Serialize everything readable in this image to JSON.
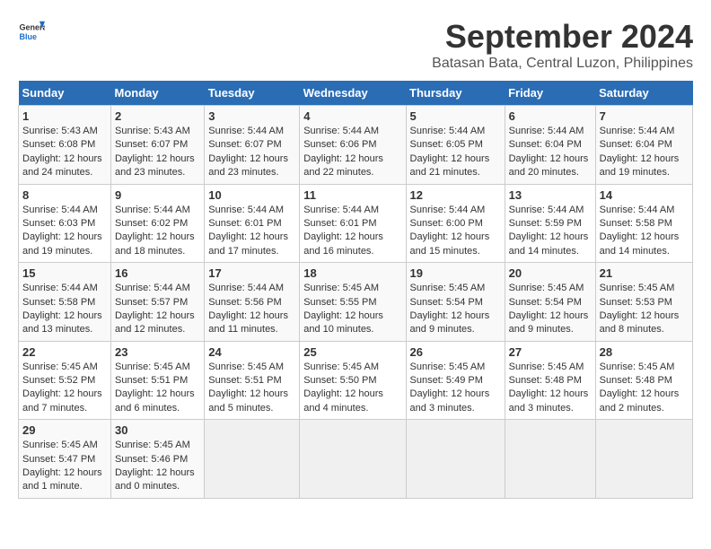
{
  "logo": {
    "line1": "General",
    "line2": "Blue"
  },
  "title": "September 2024",
  "subtitle": "Batasan Bata, Central Luzon, Philippines",
  "headers": [
    "Sunday",
    "Monday",
    "Tuesday",
    "Wednesday",
    "Thursday",
    "Friday",
    "Saturday"
  ],
  "weeks": [
    [
      {
        "day": "1",
        "sunrise": "Sunrise: 5:43 AM",
        "sunset": "Sunset: 6:08 PM",
        "daylight": "Daylight: 12 hours and 24 minutes."
      },
      {
        "day": "2",
        "sunrise": "Sunrise: 5:43 AM",
        "sunset": "Sunset: 6:07 PM",
        "daylight": "Daylight: 12 hours and 23 minutes."
      },
      {
        "day": "3",
        "sunrise": "Sunrise: 5:44 AM",
        "sunset": "Sunset: 6:07 PM",
        "daylight": "Daylight: 12 hours and 23 minutes."
      },
      {
        "day": "4",
        "sunrise": "Sunrise: 5:44 AM",
        "sunset": "Sunset: 6:06 PM",
        "daylight": "Daylight: 12 hours and 22 minutes."
      },
      {
        "day": "5",
        "sunrise": "Sunrise: 5:44 AM",
        "sunset": "Sunset: 6:05 PM",
        "daylight": "Daylight: 12 hours and 21 minutes."
      },
      {
        "day": "6",
        "sunrise": "Sunrise: 5:44 AM",
        "sunset": "Sunset: 6:04 PM",
        "daylight": "Daylight: 12 hours and 20 minutes."
      },
      {
        "day": "7",
        "sunrise": "Sunrise: 5:44 AM",
        "sunset": "Sunset: 6:04 PM",
        "daylight": "Daylight: 12 hours and 19 minutes."
      }
    ],
    [
      {
        "day": "8",
        "sunrise": "Sunrise: 5:44 AM",
        "sunset": "Sunset: 6:03 PM",
        "daylight": "Daylight: 12 hours and 19 minutes."
      },
      {
        "day": "9",
        "sunrise": "Sunrise: 5:44 AM",
        "sunset": "Sunset: 6:02 PM",
        "daylight": "Daylight: 12 hours and 18 minutes."
      },
      {
        "day": "10",
        "sunrise": "Sunrise: 5:44 AM",
        "sunset": "Sunset: 6:01 PM",
        "daylight": "Daylight: 12 hours and 17 minutes."
      },
      {
        "day": "11",
        "sunrise": "Sunrise: 5:44 AM",
        "sunset": "Sunset: 6:01 PM",
        "daylight": "Daylight: 12 hours and 16 minutes."
      },
      {
        "day": "12",
        "sunrise": "Sunrise: 5:44 AM",
        "sunset": "Sunset: 6:00 PM",
        "daylight": "Daylight: 12 hours and 15 minutes."
      },
      {
        "day": "13",
        "sunrise": "Sunrise: 5:44 AM",
        "sunset": "Sunset: 5:59 PM",
        "daylight": "Daylight: 12 hours and 14 minutes."
      },
      {
        "day": "14",
        "sunrise": "Sunrise: 5:44 AM",
        "sunset": "Sunset: 5:58 PM",
        "daylight": "Daylight: 12 hours and 14 minutes."
      }
    ],
    [
      {
        "day": "15",
        "sunrise": "Sunrise: 5:44 AM",
        "sunset": "Sunset: 5:58 PM",
        "daylight": "Daylight: 12 hours and 13 minutes."
      },
      {
        "day": "16",
        "sunrise": "Sunrise: 5:44 AM",
        "sunset": "Sunset: 5:57 PM",
        "daylight": "Daylight: 12 hours and 12 minutes."
      },
      {
        "day": "17",
        "sunrise": "Sunrise: 5:44 AM",
        "sunset": "Sunset: 5:56 PM",
        "daylight": "Daylight: 12 hours and 11 minutes."
      },
      {
        "day": "18",
        "sunrise": "Sunrise: 5:45 AM",
        "sunset": "Sunset: 5:55 PM",
        "daylight": "Daylight: 12 hours and 10 minutes."
      },
      {
        "day": "19",
        "sunrise": "Sunrise: 5:45 AM",
        "sunset": "Sunset: 5:54 PM",
        "daylight": "Daylight: 12 hours and 9 minutes."
      },
      {
        "day": "20",
        "sunrise": "Sunrise: 5:45 AM",
        "sunset": "Sunset: 5:54 PM",
        "daylight": "Daylight: 12 hours and 9 minutes."
      },
      {
        "day": "21",
        "sunrise": "Sunrise: 5:45 AM",
        "sunset": "Sunset: 5:53 PM",
        "daylight": "Daylight: 12 hours and 8 minutes."
      }
    ],
    [
      {
        "day": "22",
        "sunrise": "Sunrise: 5:45 AM",
        "sunset": "Sunset: 5:52 PM",
        "daylight": "Daylight: 12 hours and 7 minutes."
      },
      {
        "day": "23",
        "sunrise": "Sunrise: 5:45 AM",
        "sunset": "Sunset: 5:51 PM",
        "daylight": "Daylight: 12 hours and 6 minutes."
      },
      {
        "day": "24",
        "sunrise": "Sunrise: 5:45 AM",
        "sunset": "Sunset: 5:51 PM",
        "daylight": "Daylight: 12 hours and 5 minutes."
      },
      {
        "day": "25",
        "sunrise": "Sunrise: 5:45 AM",
        "sunset": "Sunset: 5:50 PM",
        "daylight": "Daylight: 12 hours and 4 minutes."
      },
      {
        "day": "26",
        "sunrise": "Sunrise: 5:45 AM",
        "sunset": "Sunset: 5:49 PM",
        "daylight": "Daylight: 12 hours and 3 minutes."
      },
      {
        "day": "27",
        "sunrise": "Sunrise: 5:45 AM",
        "sunset": "Sunset: 5:48 PM",
        "daylight": "Daylight: 12 hours and 3 minutes."
      },
      {
        "day": "28",
        "sunrise": "Sunrise: 5:45 AM",
        "sunset": "Sunset: 5:48 PM",
        "daylight": "Daylight: 12 hours and 2 minutes."
      }
    ],
    [
      {
        "day": "29",
        "sunrise": "Sunrise: 5:45 AM",
        "sunset": "Sunset: 5:47 PM",
        "daylight": "Daylight: 12 hours and 1 minute."
      },
      {
        "day": "30",
        "sunrise": "Sunrise: 5:45 AM",
        "sunset": "Sunset: 5:46 PM",
        "daylight": "Daylight: 12 hours and 0 minutes."
      },
      {
        "day": "",
        "sunrise": "",
        "sunset": "",
        "daylight": ""
      },
      {
        "day": "",
        "sunrise": "",
        "sunset": "",
        "daylight": ""
      },
      {
        "day": "",
        "sunrise": "",
        "sunset": "",
        "daylight": ""
      },
      {
        "day": "",
        "sunrise": "",
        "sunset": "",
        "daylight": ""
      },
      {
        "day": "",
        "sunrise": "",
        "sunset": "",
        "daylight": ""
      }
    ]
  ]
}
